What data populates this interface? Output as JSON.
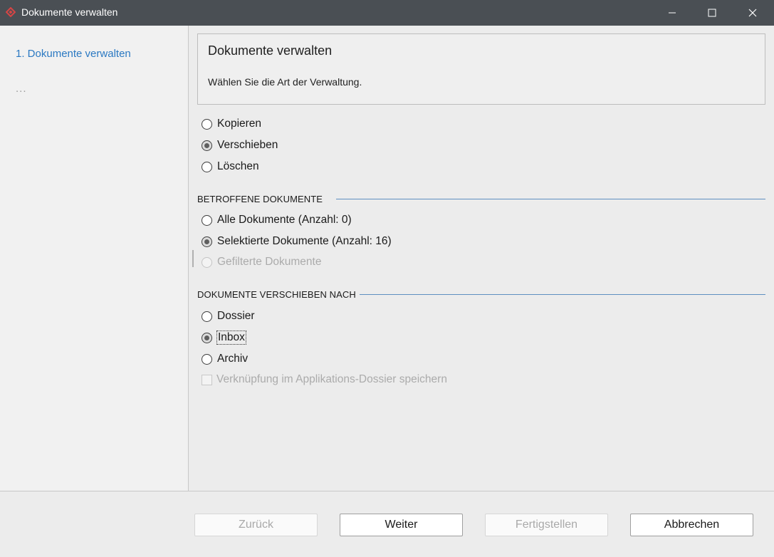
{
  "window": {
    "title": "Dokumente verwalten",
    "accent_color": "#2b79c2"
  },
  "sidebar": {
    "current_step": "1. Dokumente verwalten",
    "more_steps": "..."
  },
  "header": {
    "title": "Dokumente verwalten",
    "subtitle": "Wählen Sie die Art der Verwaltung."
  },
  "action": {
    "options": [
      {
        "label": "Kopieren",
        "checked": false
      },
      {
        "label": "Verschieben",
        "checked": true
      },
      {
        "label": "Löschen",
        "checked": false
      }
    ]
  },
  "affected": {
    "heading": "BETROFFENE DOKUMENTE",
    "options": [
      {
        "label": "Alle Dokumente (Anzahl: 0)",
        "checked": false
      },
      {
        "label": "Selektierte Dokumente (Anzahl: 16)",
        "checked": true
      },
      {
        "label": "Gefilterte Dokumente",
        "checked": false,
        "disabled": true
      }
    ]
  },
  "destination": {
    "heading": "DOKUMENTE VERSCHIEBEN NACH",
    "options": [
      {
        "label": "Dossier",
        "checked": false
      },
      {
        "label": "Inbox",
        "checked": true
      },
      {
        "label": "Archiv",
        "checked": false
      }
    ],
    "link_checkbox": {
      "label": "Verknüpfung im Applikations-Dossier speichern",
      "checked": false,
      "disabled": true
    }
  },
  "footer": {
    "back_label": "Zurück",
    "next_label": "Weiter",
    "finish_label": "Fertigstellen",
    "cancel_label": "Abbrechen"
  }
}
